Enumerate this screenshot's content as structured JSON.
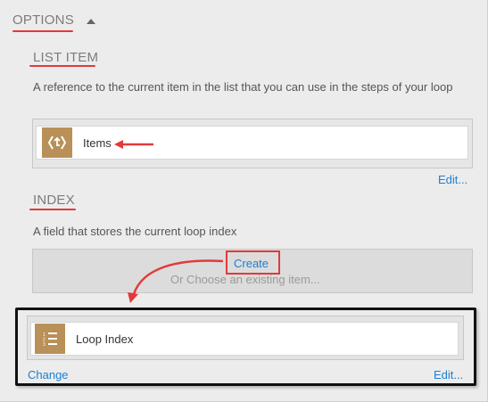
{
  "options": {
    "title": "OPTIONS",
    "toggle_icon": "caret-up-icon"
  },
  "list_item": {
    "title": "LIST ITEM",
    "description": "A reference to the current item in the list that you can use in the steps of your loop",
    "value_label": "Items",
    "value_icon": "loop-items-icon",
    "edit_label": "Edit..."
  },
  "index": {
    "title": "INDEX",
    "description": "A field that stores the current loop index",
    "create_label": "Create",
    "choose_placeholder": "Or Choose an existing item...",
    "value_label": "Loop Index",
    "value_icon": "numbered-list-icon",
    "change_label": "Change",
    "edit_label": "Edit..."
  },
  "colors": {
    "accent_red": "#e23a3a",
    "link_blue": "#1e7fd0",
    "icon_tan": "#b99058"
  }
}
